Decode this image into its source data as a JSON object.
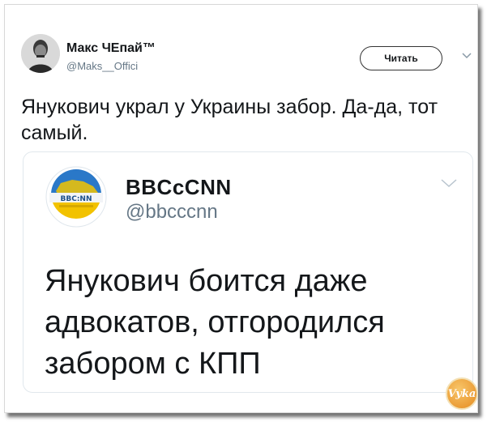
{
  "tweet": {
    "author_name": "Макс ЧЕпай™",
    "author_handle": "@Maks__Offici",
    "follow_label": "Читать",
    "text": "Янукович украл у Украины забор. Да-да, тот самый."
  },
  "quoted": {
    "author_name": "BBCcCNN",
    "author_handle": "@bbcccnn",
    "logo_text": "BBC:NN",
    "text": "Янукович боится даже адвокатов, отгородился забором с КПП"
  },
  "watermark": {
    "text": "Vyka"
  },
  "colors": {
    "text": "#14171a",
    "secondary": "#657786",
    "border": "#e1e8ed",
    "logo_blue": "#1f6fc0",
    "logo_yellow": "#f2c200"
  }
}
